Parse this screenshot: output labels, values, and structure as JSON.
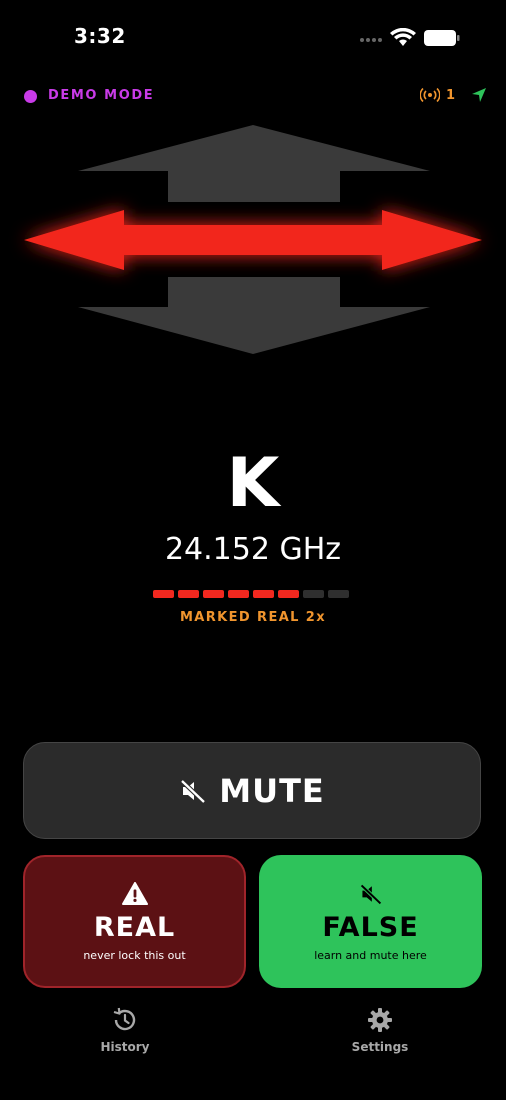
{
  "status_bar": {
    "time": "3:32"
  },
  "header": {
    "mode_label": "DEMO MODE",
    "radar_count": "1"
  },
  "alert": {
    "band": "K",
    "frequency": "24.152 GHz",
    "strength_level": 6,
    "strength_total": 8,
    "marked_text": "MARKED REAL 2x",
    "direction": "side"
  },
  "actions": {
    "mute_label": "MUTE",
    "real_label": "REAL",
    "real_sub": "never lock this out",
    "false_label": "FALSE",
    "false_sub": "learn and mute here"
  },
  "tabs": [
    {
      "label": "History",
      "icon": "history-icon"
    },
    {
      "label": "Settings",
      "icon": "gear-icon"
    }
  ],
  "colors": {
    "demo": "#c93be8",
    "warning": "#f0952e",
    "alert_red": "#f2281f",
    "false_green": "#2ec35b",
    "real_dark": "#5c1114"
  }
}
